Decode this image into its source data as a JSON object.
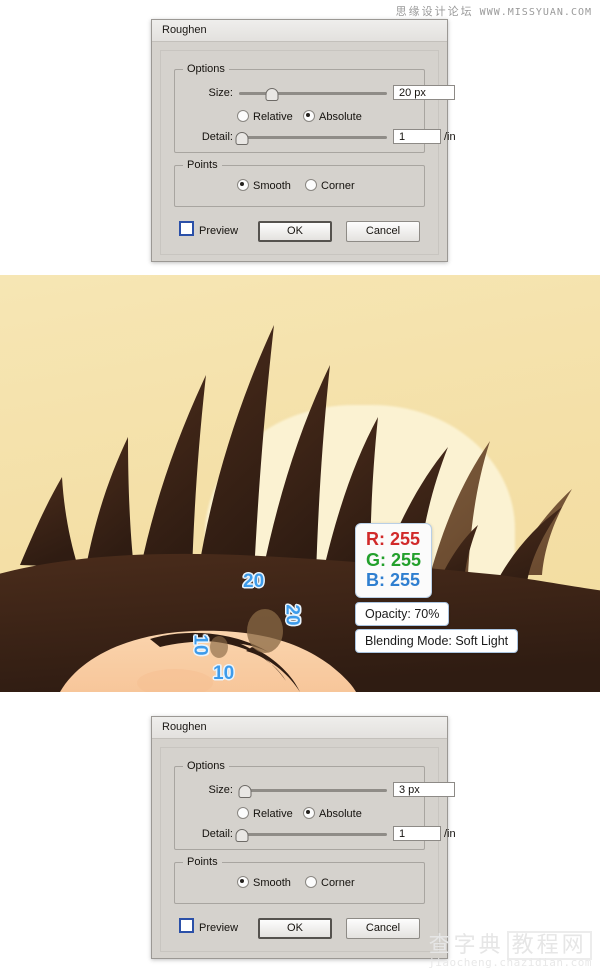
{
  "watermarks": {
    "top_cn": "思缘设计论坛",
    "top_url": "WWW.MISSYUAN.COM",
    "bottom_cn_1": "查字典",
    "bottom_cn_2": "教程网",
    "bottom_url": "jiaocheng.chazidian.com"
  },
  "dialog_top": {
    "title": "Roughen",
    "options_legend": "Options",
    "size_label": "Size:",
    "size_value": "20 px",
    "size_slider_percent": 22,
    "relative_label": "Relative",
    "absolute_label": "Absolute",
    "relative_selected": false,
    "absolute_selected": true,
    "detail_label": "Detail:",
    "detail_value": "1",
    "detail_unit": "/in",
    "detail_slider_percent": 1,
    "points_legend": "Points",
    "smooth_label": "Smooth",
    "corner_label": "Corner",
    "smooth_selected": true,
    "corner_selected": false,
    "preview_label": "Preview",
    "preview_checked": false,
    "ok_label": "OK",
    "cancel_label": "Cancel"
  },
  "dialog_bottom": {
    "title": "Roughen",
    "options_legend": "Options",
    "size_label": "Size:",
    "size_value": "3 px",
    "size_slider_percent": 3,
    "relative_label": "Relative",
    "absolute_label": "Absolute",
    "relative_selected": false,
    "absolute_selected": true,
    "detail_label": "Detail:",
    "detail_value": "1",
    "detail_unit": "/in",
    "detail_slider_percent": 1,
    "points_legend": "Points",
    "smooth_label": "Smooth",
    "corner_label": "Corner",
    "smooth_selected": true,
    "corner_selected": false,
    "preview_label": "Preview",
    "preview_checked": false,
    "ok_label": "OK",
    "cancel_label": "Cancel"
  },
  "artwork": {
    "background_color": "#f4dfa6",
    "glow_color": "#fbf2d2",
    "hair_color": "#3b2317",
    "hair_light_color": "#8a6a46",
    "skin_color": "#f9cda3",
    "annotations": {
      "size_20_a": "20",
      "size_20_b": "20",
      "size_10_a": "10",
      "size_10_b": "10",
      "rgb_r": "R: 255",
      "rgb_g": "G: 255",
      "rgb_b": "B: 255",
      "opacity": "Opacity: 70%",
      "blending": "Blending Mode: Soft Light"
    }
  }
}
